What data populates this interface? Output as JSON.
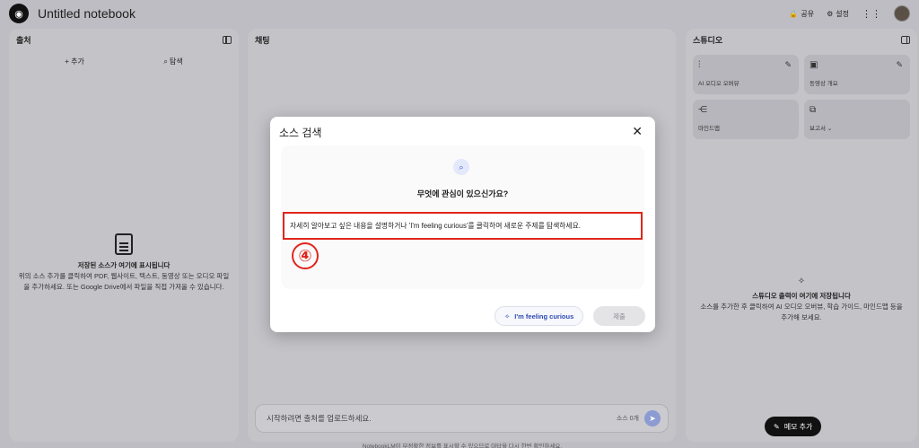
{
  "app": {
    "title": "Untitled notebook",
    "share_label": "공유",
    "settings_label": "설정"
  },
  "sources": {
    "header": "출처",
    "add_label": "추가",
    "explore_label": "탐색",
    "empty_title": "저장된 소스가 여기에 표시됩니다",
    "empty_desc": "위의 소스 추가를 클릭하여 PDF, 웹사이트, 텍스트, 동영상 또는 오디오 파일을 추가하세요. 또는 Google Drive에서 파일을 직접 가져올 수 있습니다."
  },
  "chat": {
    "header": "채팅",
    "input_placeholder": "시작하려면 출처를 업로드하세요.",
    "source_count": "소스 0개",
    "footer_note": "NotebookLM이 부정확한 정보를 표시할 수 있으므로 대답을 다시 한번 확인하세요."
  },
  "studio": {
    "header": "스튜디오",
    "cards": [
      {
        "label": "AI 오디오 오버뷰",
        "icon": "audio-waveform-icon"
      },
      {
        "label": "동영상 개요",
        "icon": "video-overview-icon"
      },
      {
        "label": "마인드맵",
        "icon": "mindmap-icon"
      },
      {
        "label": "보고서",
        "icon": "report-icon"
      }
    ],
    "empty_title": "스튜디오 출력이 여기에 저장됩니다",
    "empty_desc": "소스를 추가한 후 클릭하여 AI 오디오 오버뷰, 학습 가이드, 마인드맵 등을 추가해 보세요.",
    "memo_button": "메모 추가"
  },
  "modal": {
    "title": "소스 검색",
    "question": "무엇에 관심이 있으신가요?",
    "prompt": "자세히 알아보고 싶은 내용을 설명하거나 'I'm feeling curious'를 클릭하여 새로운 주제를 탐색하세요.",
    "step_marker": "④",
    "feeling_button": "I'm feeling curious",
    "submit_button": "제출"
  },
  "colors": {
    "highlight": "#e0261b",
    "accent": "#2c4ab4"
  }
}
